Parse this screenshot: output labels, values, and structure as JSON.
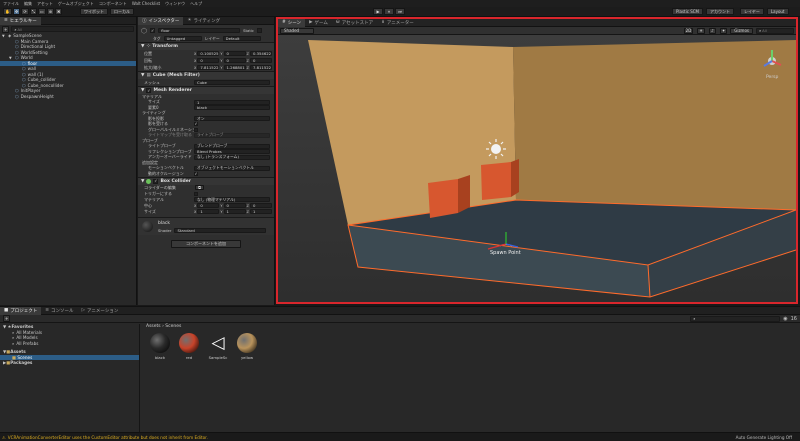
{
  "menu": [
    "ファイル",
    "編集",
    "アセット",
    "ゲームオブジェクト",
    "コンポーネント",
    "Walt Checklist",
    "ウィンドウ",
    "ヘルプ"
  ],
  "toolbar": {
    "left_buttons": [
      "✋",
      "✥",
      "⟳",
      "⤡",
      "▭",
      "⊕",
      "✖"
    ],
    "handle_mode": "ワイボット",
    "space_mode": "ローカル",
    "play_buttons": [
      "▶",
      "⏸",
      "⏭"
    ],
    "right": {
      "cloud": "Plastic SCM",
      "account": "アカウント",
      "layers": "レイヤー",
      "layout": "Layout"
    }
  },
  "hierarchy": {
    "tab": "ヒエラルキー",
    "search_placeholder": "All",
    "items": [
      {
        "label": "SampleScene",
        "indent": 0,
        "arrow": "▼",
        "icon": "unity-scene-icon",
        "selected": false
      },
      {
        "label": "Main Camera",
        "indent": 1,
        "arrow": "",
        "icon": "cube-icon",
        "selected": false
      },
      {
        "label": "Directional Light",
        "indent": 1,
        "arrow": "",
        "icon": "cube-icon",
        "selected": false
      },
      {
        "label": "WorldSetting",
        "indent": 1,
        "arrow": "",
        "icon": "cube-icon",
        "selected": false
      },
      {
        "label": "World",
        "indent": 1,
        "arrow": "▼",
        "icon": "cube-icon",
        "selected": false
      },
      {
        "label": "floor",
        "indent": 2,
        "arrow": "",
        "icon": "cube-icon",
        "selected": true
      },
      {
        "label": "wall",
        "indent": 2,
        "arrow": "",
        "icon": "cube-icon",
        "selected": false
      },
      {
        "label": "wall (1)",
        "indent": 2,
        "arrow": "",
        "icon": "cube-icon",
        "selected": false
      },
      {
        "label": "Cube_collider",
        "indent": 2,
        "arrow": "",
        "icon": "cube-icon",
        "selected": false
      },
      {
        "label": "Cube_noncollider",
        "indent": 2,
        "arrow": "",
        "icon": "cube-icon",
        "selected": false
      },
      {
        "label": "InitPlayer",
        "indent": 1,
        "arrow": "",
        "icon": "cube-icon",
        "selected": false
      },
      {
        "label": "DespawnHeight",
        "indent": 1,
        "arrow": "",
        "icon": "cube-icon",
        "selected": false
      }
    ]
  },
  "inspector": {
    "tabs": [
      "インスペクター",
      "ライティング"
    ],
    "object_name": "floor",
    "static_label": "Static",
    "tag_label": "タグ",
    "tag_value": "Untagged",
    "layer_label": "レイヤー",
    "layer_value": "Default",
    "transform": {
      "title": "Transform",
      "rows": [
        {
          "label": "位置",
          "x": "0.100525",
          "y": "0",
          "z": "0.354622"
        },
        {
          "label": "回転",
          "x": "0",
          "y": "0",
          "z": "0"
        },
        {
          "label": "拡大/縮小",
          "x": "7.811522",
          "y": "1.268801",
          "z": "7.811522"
        }
      ]
    },
    "mesh_filter": {
      "title": "Cube (Mesh Filter)",
      "mesh_label": "メッシュ",
      "mesh_value": "Cube"
    },
    "mesh_renderer": {
      "title": "Mesh Renderer",
      "materials_label": "マテリアル",
      "size_label": "サイズ",
      "size_value": "1",
      "element_label": "要素0",
      "element_value": "black",
      "lighting_label": "ライティング",
      "cast_shadows_label": "影を投影",
      "cast_shadows_value": "オン",
      "receive_shadows_label": "影を受ける",
      "global_illum_label": "グローバルイルミネーション",
      "lightmap_label": "ライトマップを受け取る",
      "lightmap_value": "ライトプローブ",
      "probes_label": "プローブ",
      "light_probes_label": "ライトプローブ",
      "light_probes_value": "ブレンドプローブ",
      "reflection_label": "リフレクションプローブ",
      "reflection_value": "Blend Probes",
      "anchor_label": "アンカーオーバーライド",
      "anchor_value": "なし (トランスフォーム)",
      "additional_label": "追加設定",
      "motion_label": "モーションベクトル",
      "motion_value": "オブジェクトモーションベクトル",
      "dynamic_label": "動的オクルージョン"
    },
    "box_collider": {
      "title": "Box Collider",
      "edit_label": "コライダーの編集",
      "trigger_label": "トリガーにする",
      "material_label": "マテリアル",
      "material_value": "なし (物理マテリアル)",
      "center_label": "中心",
      "center": {
        "x": "0",
        "y": "0",
        "z": "0"
      },
      "size_label": "サイズ",
      "size": {
        "x": "1",
        "y": "1",
        "z": "1"
      }
    },
    "material": {
      "name": "black",
      "shader_label": "Shader",
      "shader_value": "Standard"
    },
    "add_component": "コンポーネントを追加"
  },
  "scene_view": {
    "tabs": [
      "シーン",
      "ゲーム",
      "アセットストア",
      "アニメーター"
    ],
    "shading_mode": "Shaded",
    "mode_2d": "2D",
    "gizmos": "Gizmos",
    "search_placeholder": "All",
    "persp_label": "Persp",
    "spawn_label": "Spawn Point",
    "colors": {
      "wall": "#c49a5e",
      "wall_shadow": "#a07a44",
      "floor_top": "#2f3b45",
      "floor_side": "#3c4a52",
      "cube": "#d7572f",
      "outline": "#ff6b2b",
      "selection_frame": "#d9262c"
    }
  },
  "project": {
    "tabs": [
      "プロジェクト",
      "コンソール",
      "アニメーション"
    ],
    "favorites_label": "Favorites",
    "favorites": [
      "All Materials",
      "All Models",
      "All Prefabs"
    ],
    "assets_label": "Assets",
    "assets_children": [
      "Scenes"
    ],
    "packages_label": "Packages",
    "breadcrumb": "Assets › Scenes",
    "count": "16",
    "items": [
      {
        "label": "black",
        "kind": "sphere",
        "color": "#2a2a2a"
      },
      {
        "label": "red",
        "kind": "sphere",
        "color": "#c8432a"
      },
      {
        "label": "SampleSc",
        "kind": "unity",
        "color": "#ffffff"
      },
      {
        "label": "yellow",
        "kind": "sphere",
        "color": "#b9935c"
      }
    ]
  },
  "status": {
    "message": "VCRAnimationConverterEditor uses the CustomEditor attribute but does not inherit from Editor.",
    "right": "Auto Generate Lighting Off"
  }
}
